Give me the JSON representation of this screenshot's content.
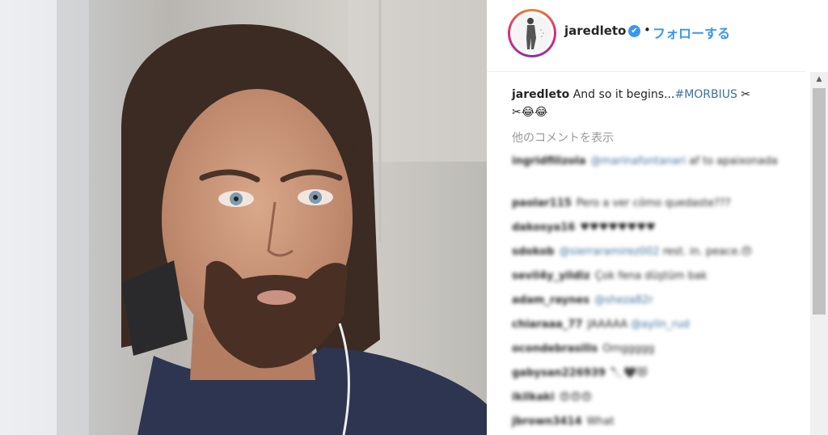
{
  "post": {
    "username": "jaredleto",
    "verified_icon": "✔",
    "separator": "•",
    "follow_label": "フォローする"
  },
  "caption": {
    "username": "jaredleto",
    "text": "And so it begins...",
    "hashtag": "#MORBIUS",
    "emoji_tail": " ✂",
    "emoji_line2": "✂😂😂"
  },
  "more_comments_label": "他のコメントを表示",
  "comments": [
    {
      "user": "ingridfilizola",
      "mention": "@marinafontanari",
      "text": " af to apaixonada"
    },
    {
      "user": "paolar115",
      "mention": "",
      "text": "Pero a ver cómo quedaste???"
    },
    {
      "user": "dakosya16",
      "mention": "",
      "text": "♥♥♥♥♥♥♥♥"
    },
    {
      "user": "sdokob",
      "mention": "@sierraramirez002",
      "text": " rest. in. peace.😔"
    },
    {
      "user": "sevil4y_yildiz",
      "mention": "",
      "text": "Çok fena düştüm bak"
    },
    {
      "user": "adam_raynes",
      "mention": "@sheza82r",
      "text": ""
    },
    {
      "user": "chiaraaa_77",
      "mention": "@aylin_rud",
      "text": "JAAAAA "
    },
    {
      "user": "ocondebrasilis",
      "mention": "",
      "text": "Omggggg"
    },
    {
      "user": "gabysan226939",
      "mention": "",
      "text": "🔪🖤😻"
    },
    {
      "user": "ikilkaki",
      "mention": "",
      "text": "😍😍😍"
    },
    {
      "user": "jbrown3414",
      "mention": "",
      "text": "What"
    }
  ],
  "icons": {
    "scroll_up": "▲"
  },
  "colors": {
    "link_blue": "#3897f0",
    "hashtag": "#3f729b",
    "muted": "#999999"
  }
}
